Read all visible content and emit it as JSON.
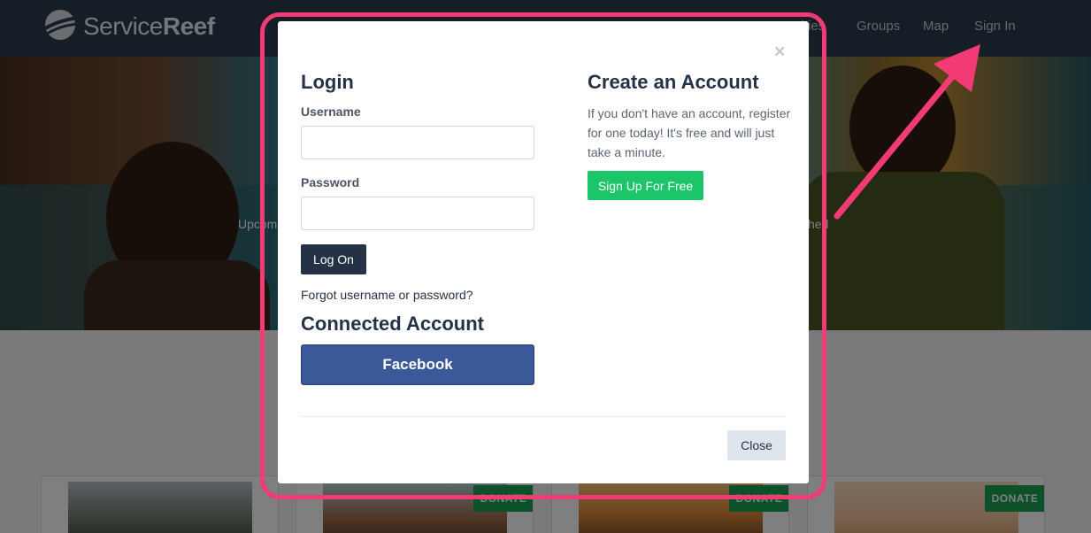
{
  "header": {
    "brand": {
      "part1": "Service",
      "part2": "Reef"
    },
    "nav": [
      {
        "label": "Opportunities"
      },
      {
        "label": "Groups"
      },
      {
        "label": "Map"
      },
      {
        "label": "Sign In"
      }
    ]
  },
  "hero": {
    "left_text": "Upcom",
    "right_text": "ched"
  },
  "cards": [
    {
      "donate_label": ""
    },
    {
      "donate_label": "DONATE"
    },
    {
      "donate_label": "DONATE"
    },
    {
      "donate_label": "DONATE"
    }
  ],
  "modal": {
    "close_x": "×",
    "login": {
      "heading": "Login",
      "username_label": "Username",
      "username_value": "",
      "password_label": "Password",
      "password_value": "",
      "logon_button": "Log On",
      "forgot_link": "Forgot username or password?",
      "connected_heading": "Connected Account",
      "facebook_button": "Facebook"
    },
    "create": {
      "heading": "Create an Account",
      "text": "If you don't have an account, register for one today! It's free and will just take a minute.",
      "signup_button": "Sign Up For Free"
    },
    "close_button": "Close"
  },
  "colors": {
    "navbar": "#2b3a4d",
    "primary_dark": "#253246",
    "facebook": "#3b5998",
    "signup_green": "#1cc46a",
    "donate_green": "#1aa355",
    "annotation_pink": "#f23a74"
  }
}
